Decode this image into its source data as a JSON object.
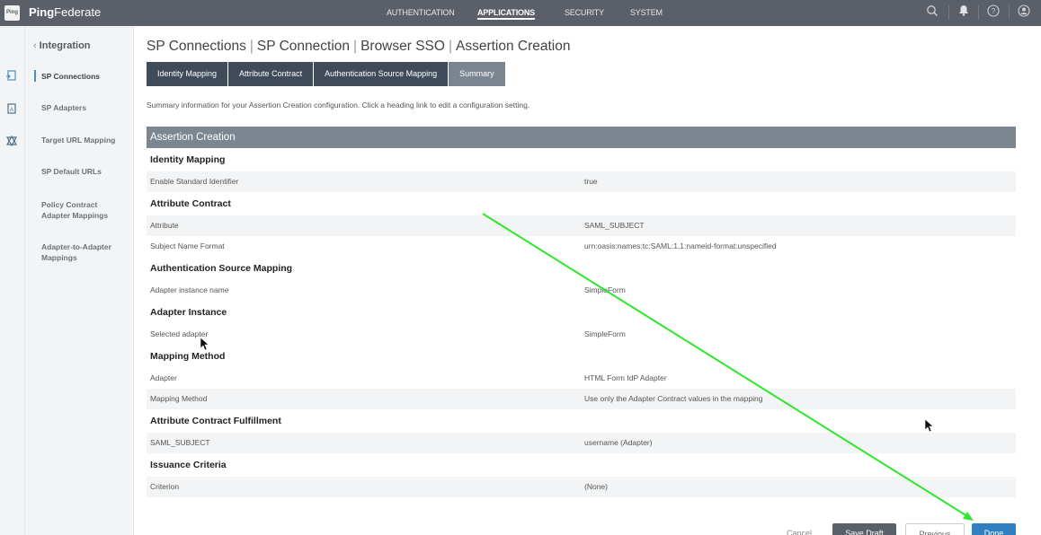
{
  "app": {
    "logo_text": "Ping",
    "brand_bold": "Ping",
    "brand_rest": "Federate"
  },
  "topnav": [
    {
      "label": "AUTHENTICATION",
      "active": false
    },
    {
      "label": "APPLICATIONS",
      "active": true
    },
    {
      "label": "SECURITY",
      "active": false
    },
    {
      "label": "SYSTEM",
      "active": false
    }
  ],
  "top_icons": [
    "search-icon",
    "bell-icon",
    "help-icon",
    "user-icon"
  ],
  "rail_icons": [
    "connection-icon",
    "adapter-icon",
    "target-icon"
  ],
  "subnav": {
    "back_label": "Integration",
    "items": [
      {
        "label": "SP Connections",
        "active": true
      },
      {
        "label": "SP Adapters"
      },
      {
        "label": "Target URL Mapping"
      },
      {
        "label": "SP Default URLs"
      },
      {
        "label": "Policy Contract Adapter Mappings"
      },
      {
        "label": "Adapter-to-Adapter Mappings"
      }
    ]
  },
  "breadcrumb": [
    "SP Connections",
    "SP Connection",
    "Browser SSO",
    "Assertion Creation"
  ],
  "tabs": [
    {
      "label": "Identity Mapping"
    },
    {
      "label": "Attribute Contract"
    },
    {
      "label": "Authentication Source Mapping"
    },
    {
      "label": "Summary",
      "active": true
    }
  ],
  "intro": "Summary information for your Assertion Creation configuration. Click a heading link to edit a configuration setting.",
  "summary": {
    "header": "Assertion Creation",
    "sections": [
      {
        "title": "Identity Mapping",
        "rows": [
          {
            "key": "Enable Standard Identifier",
            "value": "true"
          }
        ]
      },
      {
        "title": "Attribute Contract",
        "rows": [
          {
            "key": "Attribute",
            "value": "SAML_SUBJECT"
          },
          {
            "key": "Subject Name Format",
            "value": "urn:oasis:names:tc:SAML:1.1:nameid-format:unspecified"
          }
        ]
      },
      {
        "title": "Authentication Source Mapping",
        "rows": [
          {
            "key": "Adapter instance name",
            "value": "SimpleForm"
          }
        ]
      },
      {
        "title": "Adapter Instance",
        "rows": [
          {
            "key": "Selected adapter",
            "value": "SimpleForm"
          }
        ]
      },
      {
        "title": "Mapping Method",
        "rows": [
          {
            "key": "Adapter",
            "value": "HTML Form IdP Adapter"
          },
          {
            "key": "Mapping Method",
            "value": "Use only the Adapter Contract values in the mapping"
          }
        ]
      },
      {
        "title": "Attribute Contract Fulfillment",
        "rows": [
          {
            "key": "SAML_SUBJECT",
            "value": "username (Adapter)"
          }
        ]
      },
      {
        "title": "Issuance Criteria",
        "rows": [
          {
            "key": "Criterion",
            "value": "(None)"
          }
        ]
      }
    ]
  },
  "buttons": {
    "cancel": "Cancel",
    "save_draft": "Save Draft",
    "previous": "Previous",
    "done": "Done"
  },
  "colors": {
    "topbar": "#5b6068",
    "tab": "#3f4b5b",
    "tab_active": "#7b8590",
    "table_header": "#7c8691",
    "accent": "#2f7fc1",
    "annotation": "#2ee82e"
  }
}
